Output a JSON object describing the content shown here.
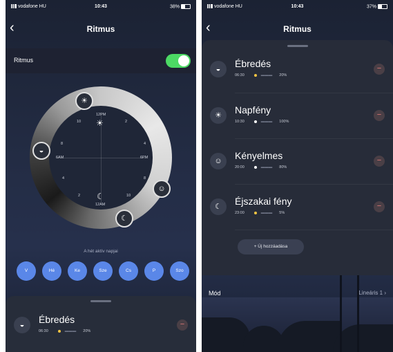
{
  "status_left": {
    "carrier": "vodafone HU",
    "time": "10:43",
    "battery": "38%"
  },
  "status_right": {
    "carrier": "vodafone HU",
    "time": "10:43",
    "battery": "37%"
  },
  "left": {
    "title": "Ritmus",
    "toggle_label": "Ritmus",
    "toggle_on": true,
    "clock": {
      "top": "12PM",
      "bottom": "12AM",
      "left": "6AM",
      "right": "6PM",
      "ticks": [
        "10",
        "2",
        "8",
        "4",
        "4",
        "8",
        "2",
        "10"
      ]
    },
    "days_label": "A hét aktív napjai",
    "days": [
      "V",
      "Hé",
      "Ke",
      "Sze",
      "Cs",
      "P",
      "Szo"
    ],
    "items": [
      {
        "name": "Ébredés",
        "time": "06:30",
        "level": "20%"
      }
    ]
  },
  "right": {
    "title": "Ritmus",
    "items": [
      {
        "name": "Ébredés",
        "time": "06:30",
        "level": "20%"
      },
      {
        "name": "Napfény",
        "time": "10:30",
        "level": "100%"
      },
      {
        "name": "Kényelmes",
        "time": "20:00",
        "level": "80%"
      },
      {
        "name": "Éjszakai fény",
        "time": "23:00",
        "level": "5%"
      }
    ],
    "add_label": "+ Új hozzáadása",
    "mode_label": "Mód",
    "mode_value": "Lineáris 1"
  },
  "colors": {
    "toggle": "#4cd964",
    "day_active": "#5a87e8",
    "remove": "#e37b7b",
    "dot": "#f5c542"
  },
  "icons": {
    "wake": "sunrise-icon",
    "sun": "sun-icon",
    "cozy": "smile-icon",
    "night": "moon-icon",
    "back": "chevron-left-icon",
    "remove": "minus-icon"
  }
}
